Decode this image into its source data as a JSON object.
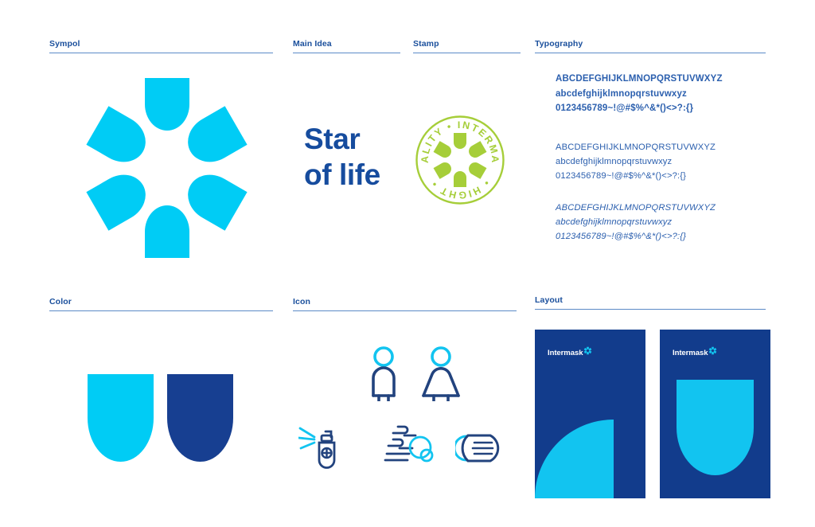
{
  "brand": {
    "name": "Intermask",
    "colors": {
      "cyan": "#00ccf5",
      "navy": "#173f91",
      "navy_deep": "#123c8c",
      "heading_blue": "#1a4f9c",
      "rule_blue": "#5b8ac7",
      "type_blue": "#2b5fae",
      "stamp_green": "#a6ce39",
      "icon_navy": "#22437e",
      "white": "#ffffff"
    }
  },
  "sections": {
    "symbol": {
      "label": "Sympol",
      "description": "six-petal star of life mark"
    },
    "main_idea": {
      "label": "Main Idea",
      "line1": "Star",
      "line2": "of life"
    },
    "stamp": {
      "label": "Stamp",
      "text_top": "QUALITY",
      "text_brand": "INTERMASK",
      "text_bottom": "HIGHT",
      "separator": "•",
      "full_text": "QUALITY • INTERMASK • HIGHT"
    },
    "typography": {
      "label": "Typography",
      "samples": [
        {
          "weight": "bold",
          "uppercase": "ABCDEFGHIJKLMNOPQRSTUVWXYZ",
          "lowercase": "abcdefghijklmnopqrstuvwxyz",
          "glyphs": "0123456789~!@#$%^&*()<>?:{}"
        },
        {
          "weight": "regular",
          "uppercase": "ABCDEFGHIJKLMNOPQRSTUVWXYZ",
          "lowercase": "abcdefghijklmnopqrstuvwxyz",
          "glyphs": "0123456789~!@#$%^&*()<>?:{}"
        },
        {
          "weight": "italic",
          "uppercase": "ABCDEFGHIJKLMNOPQRSTUVWXYZ",
          "lowercase": "abcdefghijklmnopqrstuvwxyz",
          "glyphs": "0123456789~!@#$%^&*()<>?:{}"
        }
      ]
    },
    "color": {
      "label": "Color",
      "swatches": [
        {
          "name": "primary-cyan",
          "hex": "#00ccf5"
        },
        {
          "name": "primary-navy",
          "hex": "#173f91"
        }
      ]
    },
    "icon": {
      "label": "Icon",
      "items": [
        {
          "name": "male-figure-icon"
        },
        {
          "name": "female-figure-icon"
        },
        {
          "name": "spray-sanitizer-icon"
        },
        {
          "name": "hand-washing-icon"
        },
        {
          "name": "face-mask-icon"
        }
      ]
    },
    "layout": {
      "label": "Layout",
      "cards": [
        {
          "name": "layout-card-corner",
          "logo": "Intermask",
          "shape": "quarter-circle-bottom-left"
        },
        {
          "name": "layout-card-petal",
          "logo": "Intermask",
          "shape": "large-petal-centered"
        }
      ]
    }
  }
}
